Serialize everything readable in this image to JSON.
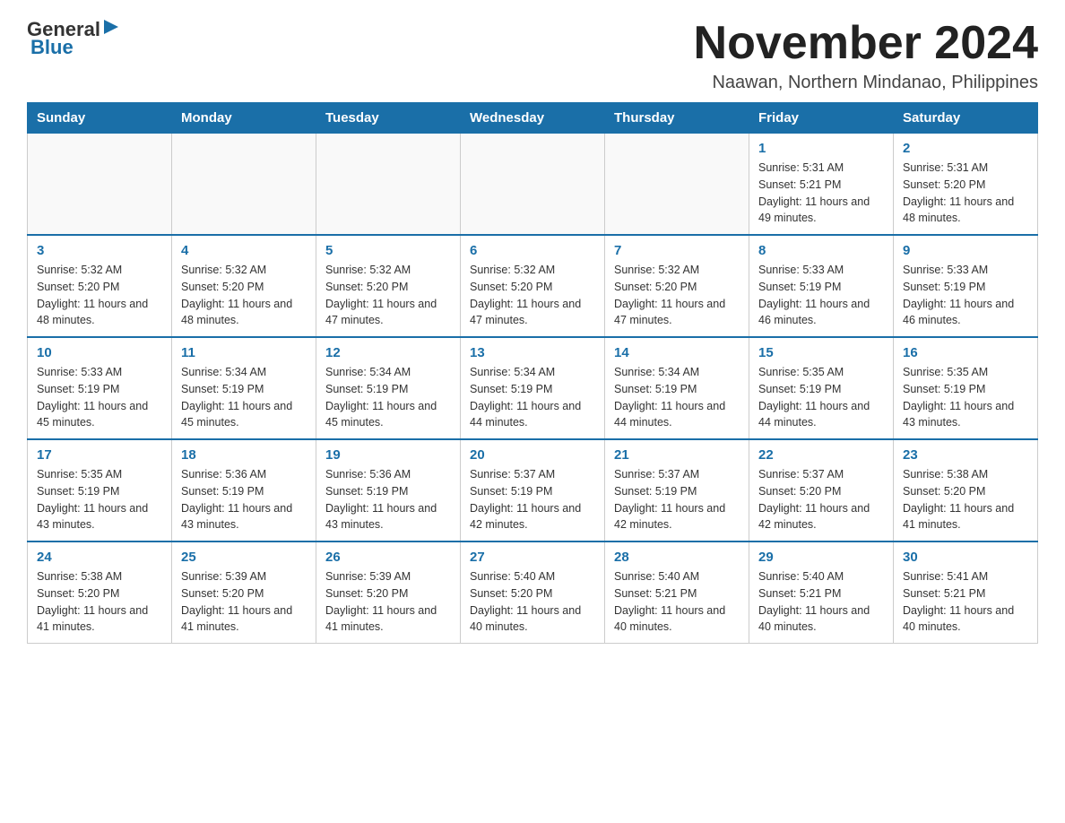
{
  "header": {
    "logo_general": "General",
    "logo_blue": "Blue",
    "month_title": "November 2024",
    "location": "Naawan, Northern Mindanao, Philippines"
  },
  "days_of_week": [
    "Sunday",
    "Monday",
    "Tuesday",
    "Wednesday",
    "Thursday",
    "Friday",
    "Saturday"
  ],
  "weeks": [
    [
      {
        "day": "",
        "info": ""
      },
      {
        "day": "",
        "info": ""
      },
      {
        "day": "",
        "info": ""
      },
      {
        "day": "",
        "info": ""
      },
      {
        "day": "",
        "info": ""
      },
      {
        "day": "1",
        "info": "Sunrise: 5:31 AM\nSunset: 5:21 PM\nDaylight: 11 hours and 49 minutes."
      },
      {
        "day": "2",
        "info": "Sunrise: 5:31 AM\nSunset: 5:20 PM\nDaylight: 11 hours and 48 minutes."
      }
    ],
    [
      {
        "day": "3",
        "info": "Sunrise: 5:32 AM\nSunset: 5:20 PM\nDaylight: 11 hours and 48 minutes."
      },
      {
        "day": "4",
        "info": "Sunrise: 5:32 AM\nSunset: 5:20 PM\nDaylight: 11 hours and 48 minutes."
      },
      {
        "day": "5",
        "info": "Sunrise: 5:32 AM\nSunset: 5:20 PM\nDaylight: 11 hours and 47 minutes."
      },
      {
        "day": "6",
        "info": "Sunrise: 5:32 AM\nSunset: 5:20 PM\nDaylight: 11 hours and 47 minutes."
      },
      {
        "day": "7",
        "info": "Sunrise: 5:32 AM\nSunset: 5:20 PM\nDaylight: 11 hours and 47 minutes."
      },
      {
        "day": "8",
        "info": "Sunrise: 5:33 AM\nSunset: 5:19 PM\nDaylight: 11 hours and 46 minutes."
      },
      {
        "day": "9",
        "info": "Sunrise: 5:33 AM\nSunset: 5:19 PM\nDaylight: 11 hours and 46 minutes."
      }
    ],
    [
      {
        "day": "10",
        "info": "Sunrise: 5:33 AM\nSunset: 5:19 PM\nDaylight: 11 hours and 45 minutes."
      },
      {
        "day": "11",
        "info": "Sunrise: 5:34 AM\nSunset: 5:19 PM\nDaylight: 11 hours and 45 minutes."
      },
      {
        "day": "12",
        "info": "Sunrise: 5:34 AM\nSunset: 5:19 PM\nDaylight: 11 hours and 45 minutes."
      },
      {
        "day": "13",
        "info": "Sunrise: 5:34 AM\nSunset: 5:19 PM\nDaylight: 11 hours and 44 minutes."
      },
      {
        "day": "14",
        "info": "Sunrise: 5:34 AM\nSunset: 5:19 PM\nDaylight: 11 hours and 44 minutes."
      },
      {
        "day": "15",
        "info": "Sunrise: 5:35 AM\nSunset: 5:19 PM\nDaylight: 11 hours and 44 minutes."
      },
      {
        "day": "16",
        "info": "Sunrise: 5:35 AM\nSunset: 5:19 PM\nDaylight: 11 hours and 43 minutes."
      }
    ],
    [
      {
        "day": "17",
        "info": "Sunrise: 5:35 AM\nSunset: 5:19 PM\nDaylight: 11 hours and 43 minutes."
      },
      {
        "day": "18",
        "info": "Sunrise: 5:36 AM\nSunset: 5:19 PM\nDaylight: 11 hours and 43 minutes."
      },
      {
        "day": "19",
        "info": "Sunrise: 5:36 AM\nSunset: 5:19 PM\nDaylight: 11 hours and 43 minutes."
      },
      {
        "day": "20",
        "info": "Sunrise: 5:37 AM\nSunset: 5:19 PM\nDaylight: 11 hours and 42 minutes."
      },
      {
        "day": "21",
        "info": "Sunrise: 5:37 AM\nSunset: 5:19 PM\nDaylight: 11 hours and 42 minutes."
      },
      {
        "day": "22",
        "info": "Sunrise: 5:37 AM\nSunset: 5:20 PM\nDaylight: 11 hours and 42 minutes."
      },
      {
        "day": "23",
        "info": "Sunrise: 5:38 AM\nSunset: 5:20 PM\nDaylight: 11 hours and 41 minutes."
      }
    ],
    [
      {
        "day": "24",
        "info": "Sunrise: 5:38 AM\nSunset: 5:20 PM\nDaylight: 11 hours and 41 minutes."
      },
      {
        "day": "25",
        "info": "Sunrise: 5:39 AM\nSunset: 5:20 PM\nDaylight: 11 hours and 41 minutes."
      },
      {
        "day": "26",
        "info": "Sunrise: 5:39 AM\nSunset: 5:20 PM\nDaylight: 11 hours and 41 minutes."
      },
      {
        "day": "27",
        "info": "Sunrise: 5:40 AM\nSunset: 5:20 PM\nDaylight: 11 hours and 40 minutes."
      },
      {
        "day": "28",
        "info": "Sunrise: 5:40 AM\nSunset: 5:21 PM\nDaylight: 11 hours and 40 minutes."
      },
      {
        "day": "29",
        "info": "Sunrise: 5:40 AM\nSunset: 5:21 PM\nDaylight: 11 hours and 40 minutes."
      },
      {
        "day": "30",
        "info": "Sunrise: 5:41 AM\nSunset: 5:21 PM\nDaylight: 11 hours and 40 minutes."
      }
    ]
  ]
}
